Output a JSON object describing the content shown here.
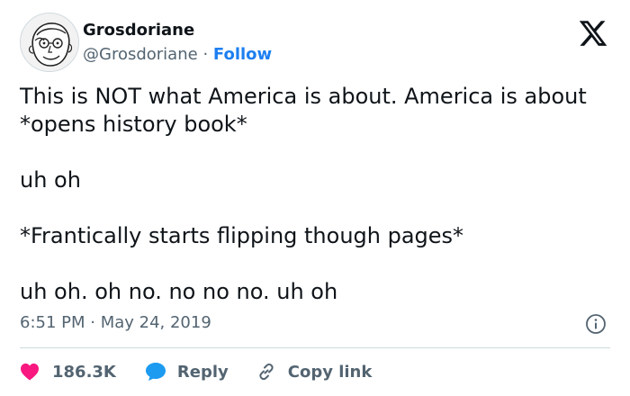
{
  "tweet": {
    "display_name": "Grosdoriane",
    "handle": "@Grosdoriane",
    "separator": "·",
    "follow_label": "Follow",
    "paragraphs": [
      "This is NOT what America is about. America is about *opens history book*",
      "uh oh",
      "*Frantically starts flipping though pages*",
      "uh oh. oh no. no no no. uh oh"
    ],
    "timestamp": "6:51 PM · May 24, 2019",
    "likes": "186.3K",
    "reply_label": "Reply",
    "copy_link_label": "Copy link"
  },
  "icons": {
    "avatar": "avatar-sketch",
    "logo": "x-logo-icon",
    "info": "info-icon",
    "like": "heart-icon",
    "reply": "speech-bubble-icon",
    "copy": "link-icon"
  },
  "colors": {
    "text": "#0f1419",
    "secondary": "#536471",
    "link": "#1d7ff0",
    "heart": "#f91880",
    "reply_bubble": "#1d9bf0",
    "divider": "#cfd9de"
  }
}
